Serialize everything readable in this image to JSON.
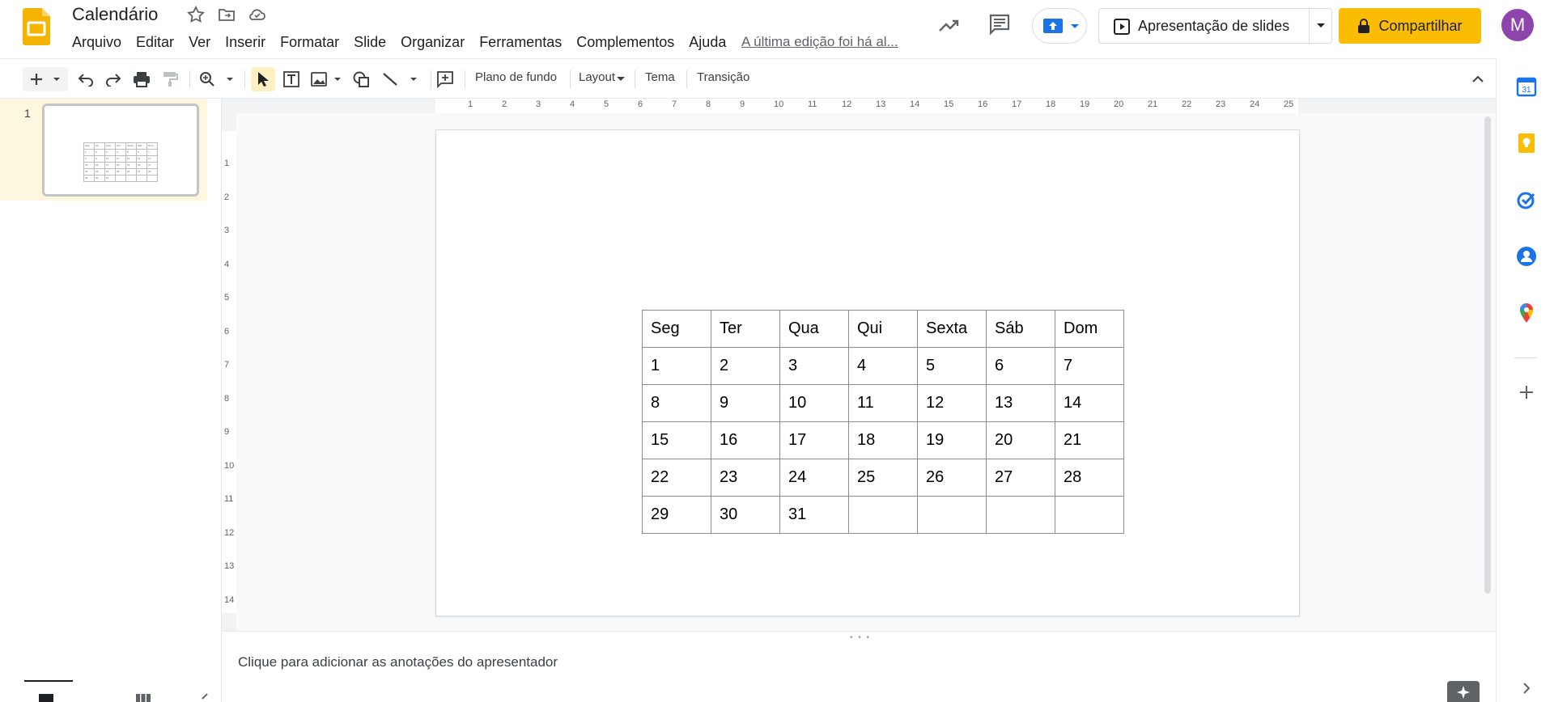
{
  "header": {
    "title": "Calendário",
    "last_edit": "A última edição foi há al...",
    "menu": [
      "Arquivo",
      "Editar",
      "Ver",
      "Inserir",
      "Formatar",
      "Slide",
      "Organizar",
      "Ferramentas",
      "Complementos",
      "Ajuda"
    ],
    "present_label": "Apresentação de slides",
    "share_label": "Compartilhar",
    "avatar_letter": "M"
  },
  "toolbar": {
    "background_label": "Plano de fundo",
    "layout_label": "Layout",
    "theme_label": "Tema",
    "transition_label": "Transição"
  },
  "filmstrip": {
    "slide_number": "1"
  },
  "ruler": {
    "h_ticks": [
      "1",
      "2",
      "3",
      "4",
      "5",
      "6",
      "7",
      "8",
      "9",
      "10",
      "11",
      "12",
      "13",
      "14",
      "15",
      "16",
      "17",
      "18",
      "19",
      "20",
      "21",
      "22",
      "23",
      "24",
      "25"
    ],
    "v_ticks": [
      "1",
      "2",
      "3",
      "4",
      "5",
      "6",
      "7",
      "8",
      "9",
      "10",
      "11",
      "12",
      "13",
      "14"
    ]
  },
  "calendar": {
    "header": [
      "Seg",
      "Ter",
      "Qua",
      "Qui",
      "Sexta",
      "Sáb",
      "Dom"
    ],
    "rows": [
      [
        "1",
        "2",
        "3",
        "4",
        "5",
        "6",
        "7"
      ],
      [
        "8",
        "9",
        "10",
        "11",
        "12",
        "13",
        "14"
      ],
      [
        "15",
        "16",
        "17",
        "18",
        "19",
        "20",
        "21"
      ],
      [
        "22",
        "23",
        "24",
        "25",
        "26",
        "27",
        "28"
      ],
      [
        "29",
        "30",
        "31",
        "",
        "",
        "",
        ""
      ]
    ]
  },
  "notes": {
    "placeholder": "Clique para adicionar as anotações do apresentador"
  },
  "colors": {
    "share": "#fbbc04",
    "avatar": "#8e44ad",
    "logo": "#f4b400"
  }
}
